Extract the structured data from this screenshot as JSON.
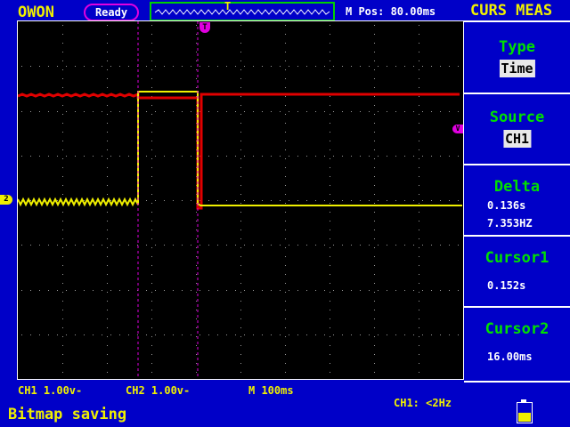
{
  "header": {
    "brand": "OWON",
    "status": "Ready",
    "trigger_marker": "T",
    "mpos": "M Pos: 80.00ms",
    "menu_title": "CURS MEAS"
  },
  "menu": {
    "type": {
      "label": "Type",
      "value": "Time"
    },
    "source": {
      "label": "Source",
      "value": "CH1"
    },
    "delta": {
      "label": "Delta",
      "time": "0.136s",
      "freq": "7.353HZ"
    },
    "cursor1": {
      "label": "Cursor1",
      "value": "0.152s"
    },
    "cursor2": {
      "label": "Cursor2",
      "value": "16.00ms"
    }
  },
  "footer": {
    "ch1_scale": "CH1 1.00v-",
    "ch2_scale": "CH2 1.00v-",
    "time_scale": "M  100ms",
    "trigger_info": "CH1: <2Hz",
    "message": "Bitmap saving"
  },
  "markers": {
    "ch2": "2",
    "trigger_level": "V",
    "trigger_pos": "T"
  },
  "colors": {
    "background": "#0000c8",
    "screen": "#000000",
    "ch1": "#f0f000",
    "ch2": "#e00000",
    "cursor": "#e000e0",
    "grid": "#9a9a9a",
    "menu_label": "#00e000"
  },
  "battery": {
    "level": 0.5
  }
}
